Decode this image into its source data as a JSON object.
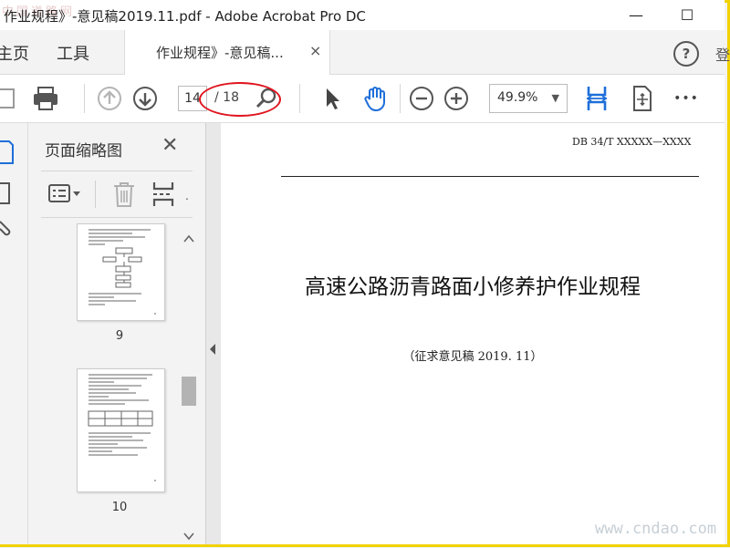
{
  "window": {
    "title": "作业规程》-意见稿2019.11.pdf - Adobe Acrobat Pro DC",
    "watermark_top": "中国道路网",
    "minimize": "—",
    "maximize": "☐"
  },
  "menu": {
    "home": "主页",
    "tools": "工具",
    "tab_label": "作业规程》-意见稿...",
    "tab_close": "×",
    "help": "?",
    "edge_text": "登"
  },
  "toolbar": {
    "current_page": "14",
    "page_total": "/ 18",
    "zoom": "49.9%",
    "zoom_arrow": "▼",
    "more": "•••"
  },
  "thumbnails": {
    "title": "页面缩略图",
    "close": "✕",
    "pages": [
      {
        "label": "9"
      },
      {
        "label": "10"
      }
    ]
  },
  "document": {
    "header_code": "DB 34/T XXXXX—XXXX",
    "title": "高速公路沥青路面小修养护作业规程",
    "subtitle": "（征求意见稿 2019. 11）"
  },
  "watermark_bottom": "www.cndao.com",
  "colors": {
    "accent_blue": "#1e6fd9",
    "annotation_red": "#e0141e",
    "frame_yellow": "#f2d200"
  }
}
